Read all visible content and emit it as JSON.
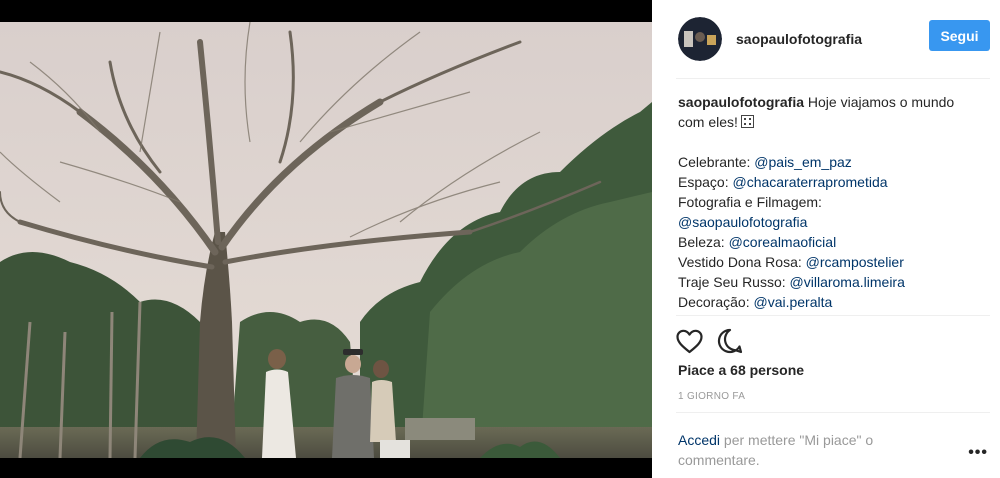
{
  "header": {
    "username": "saopaulofotografia",
    "follow_label": "Segui"
  },
  "caption": {
    "author": "saopaulofotografia",
    "text": "Hoje viajamos o mundo com eles!",
    "emoji_icon": "film-frames-icon",
    "credits": [
      {
        "label": "Celebrante:",
        "handle": "@pais_em_paz"
      },
      {
        "label": "Espaço:",
        "handle": "@chacaraterraprometida"
      },
      {
        "label": "Fotografia e Filmagem:",
        "handle": "@saopaulofotografia"
      },
      {
        "label": "Beleza:",
        "handle": "@corealmaoficial"
      },
      {
        "label": "Vestido Dona Rosa:",
        "handle": "@rcampostelier"
      },
      {
        "label": "Traje Seu Russo:",
        "handle": "@villaroma.limeira"
      },
      {
        "label": "Decoração:",
        "handle": "@vai.peralta"
      }
    ]
  },
  "actions": {
    "like_icon": "heart-icon",
    "comment_icon": "comment-icon"
  },
  "likes_text": "Piace a 68 persone",
  "timestamp": "1 giorno fa",
  "login_prompt": {
    "link": "Accedi",
    "text": "per mettere \"Mi piace\" o commentare."
  },
  "more_label": "•••",
  "colors": {
    "accent": "#3897f0",
    "link": "#003569",
    "muted": "#999999"
  }
}
